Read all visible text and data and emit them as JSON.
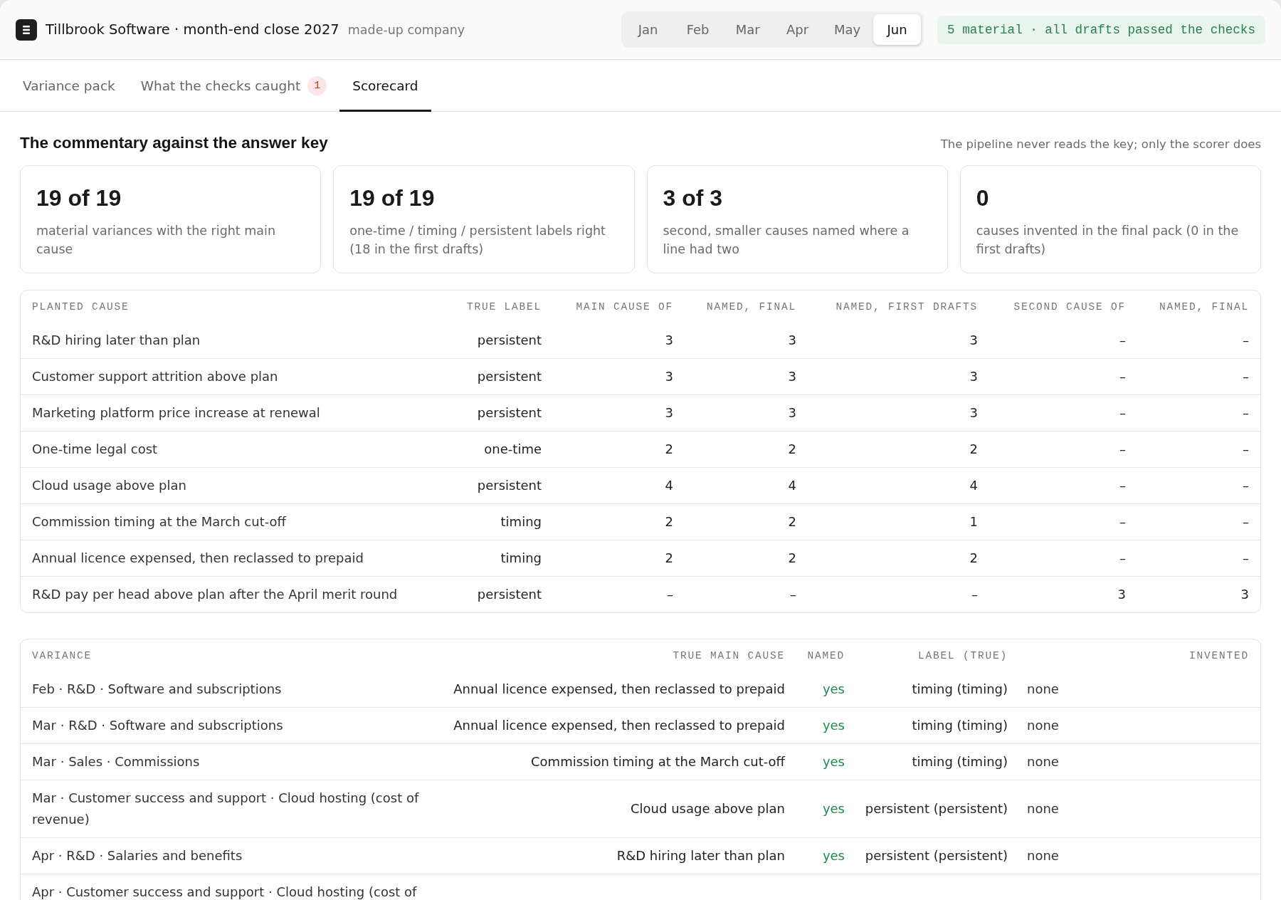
{
  "header": {
    "title": "Tillbrook Software · month-end close 2027",
    "subtitle": "made-up company",
    "months": [
      {
        "label": "Jan",
        "selected": false
      },
      {
        "label": "Feb",
        "selected": false
      },
      {
        "label": "Mar",
        "selected": false
      },
      {
        "label": "Apr",
        "selected": false
      },
      {
        "label": "May",
        "selected": false
      },
      {
        "label": "Jun",
        "selected": true
      }
    ],
    "status": "5 material · all drafts passed the checks"
  },
  "tabs": [
    {
      "label": "Variance pack",
      "selected": false
    },
    {
      "label": "What the checks caught",
      "badge": "1",
      "selected": false
    },
    {
      "label": "Scorecard",
      "selected": true
    }
  ],
  "section": {
    "title": "The commentary against the answer key",
    "note": "The pipeline never reads the key; only the scorer does"
  },
  "cards": [
    {
      "value": "19 of 19",
      "caption": "material variances with the right main cause"
    },
    {
      "value": "19 of 19",
      "caption": "one-time / timing / persistent labels right (18 in the first drafts)"
    },
    {
      "value": "3 of 3",
      "caption": "second, smaller causes named where a line had two"
    },
    {
      "value": "0",
      "caption": "causes invented in the final pack (0 in the first drafts)"
    }
  ],
  "causes_table": {
    "columns": [
      "PLANTED CAUSE",
      "TRUE LABEL",
      "MAIN CAUSE OF",
      "NAMED, FINAL",
      "NAMED, FIRST DRAFTS",
      "SECOND CAUSE OF",
      "NAMED, FINAL"
    ],
    "rows": [
      [
        "R&D hiring later than plan",
        "persistent",
        "3",
        "3",
        "3",
        "–",
        "–"
      ],
      [
        "Customer support attrition above plan",
        "persistent",
        "3",
        "3",
        "3",
        "–",
        "–"
      ],
      [
        "Marketing platform price increase at renewal",
        "persistent",
        "3",
        "3",
        "3",
        "–",
        "–"
      ],
      [
        "One-time legal cost",
        "one-time",
        "2",
        "2",
        "2",
        "–",
        "–"
      ],
      [
        "Cloud usage above plan",
        "persistent",
        "4",
        "4",
        "4",
        "–",
        "–"
      ],
      [
        "Commission timing at the March cut-off",
        "timing",
        "2",
        "2",
        "1",
        "–",
        "–"
      ],
      [
        "Annual licence expensed, then reclassed to prepaid",
        "timing",
        "2",
        "2",
        "2",
        "–",
        "–"
      ],
      [
        "R&D pay per head above plan after the April merit round",
        "persistent",
        "–",
        "–",
        "–",
        "3",
        "3"
      ]
    ]
  },
  "variances_table": {
    "columns": [
      "VARIANCE",
      "TRUE MAIN CAUSE",
      "NAMED",
      "LABEL (TRUE)",
      "INVENTED"
    ],
    "rows": [
      {
        "variance": "Feb · R&D · Software and subscriptions",
        "true_main_cause": "Annual licence expensed, then reclassed to prepaid",
        "named": "yes",
        "label": "timing (timing)",
        "invented": "none"
      },
      {
        "variance": "Mar · R&D · Software and subscriptions",
        "true_main_cause": "Annual licence expensed, then reclassed to prepaid",
        "named": "yes",
        "label": "timing (timing)",
        "invented": "none"
      },
      {
        "variance": "Mar · Sales · Commissions",
        "true_main_cause": "Commission timing at the March cut-off",
        "named": "yes",
        "label": "timing (timing)",
        "invented": "none"
      },
      {
        "variance": "Mar · Customer success and support · Cloud hosting (cost of revenue)",
        "true_main_cause": "Cloud usage above plan",
        "named": "yes",
        "label": "persistent (persistent)",
        "invented": "none"
      },
      {
        "variance": "Apr · R&D · Salaries and benefits",
        "true_main_cause": "R&D hiring later than plan",
        "named": "yes",
        "label": "persistent (persistent)",
        "invented": "none"
      },
      {
        "variance": "Apr · Customer success and support · Cloud hosting (cost of"
      }
    ]
  }
}
